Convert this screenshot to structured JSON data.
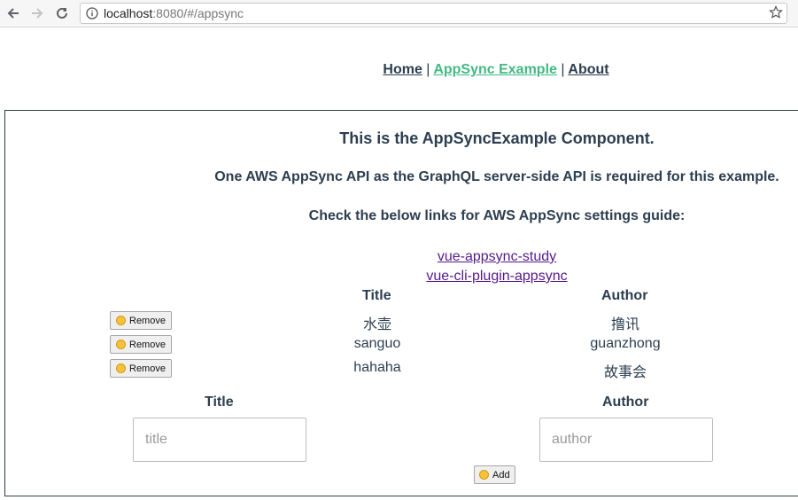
{
  "browser": {
    "url_host": "localhost",
    "url_rest": ":8080/#/appsync"
  },
  "nav": {
    "home": "Home",
    "appsync": "AppSync Example",
    "about": "About",
    "separator": "|"
  },
  "component": {
    "heading": "This is the AppSyncExample Component.",
    "requirement": "One AWS AppSync API as the GraphQL server-side API is required for this example.",
    "guide": "Check the below links for AWS AppSync settings guide:",
    "links": [
      "vue-appsync-study",
      "vue-cli-plugin-appsync"
    ]
  },
  "table": {
    "columns": [
      "Title",
      "Author"
    ],
    "remove_label": "Remove",
    "rows": [
      {
        "title": "水壶",
        "author": "撸讯"
      },
      {
        "title": "sanguo",
        "author": "guanzhong"
      },
      {
        "title": "hahaha",
        "author": "故事会"
      }
    ]
  },
  "form": {
    "title_label": "Title",
    "author_label": "Author",
    "title_placeholder": "title",
    "author_placeholder": "author",
    "add_label": "Add"
  },
  "icons": {
    "remove": "worried-face-emoji",
    "add": "smiling-face-emoji"
  }
}
